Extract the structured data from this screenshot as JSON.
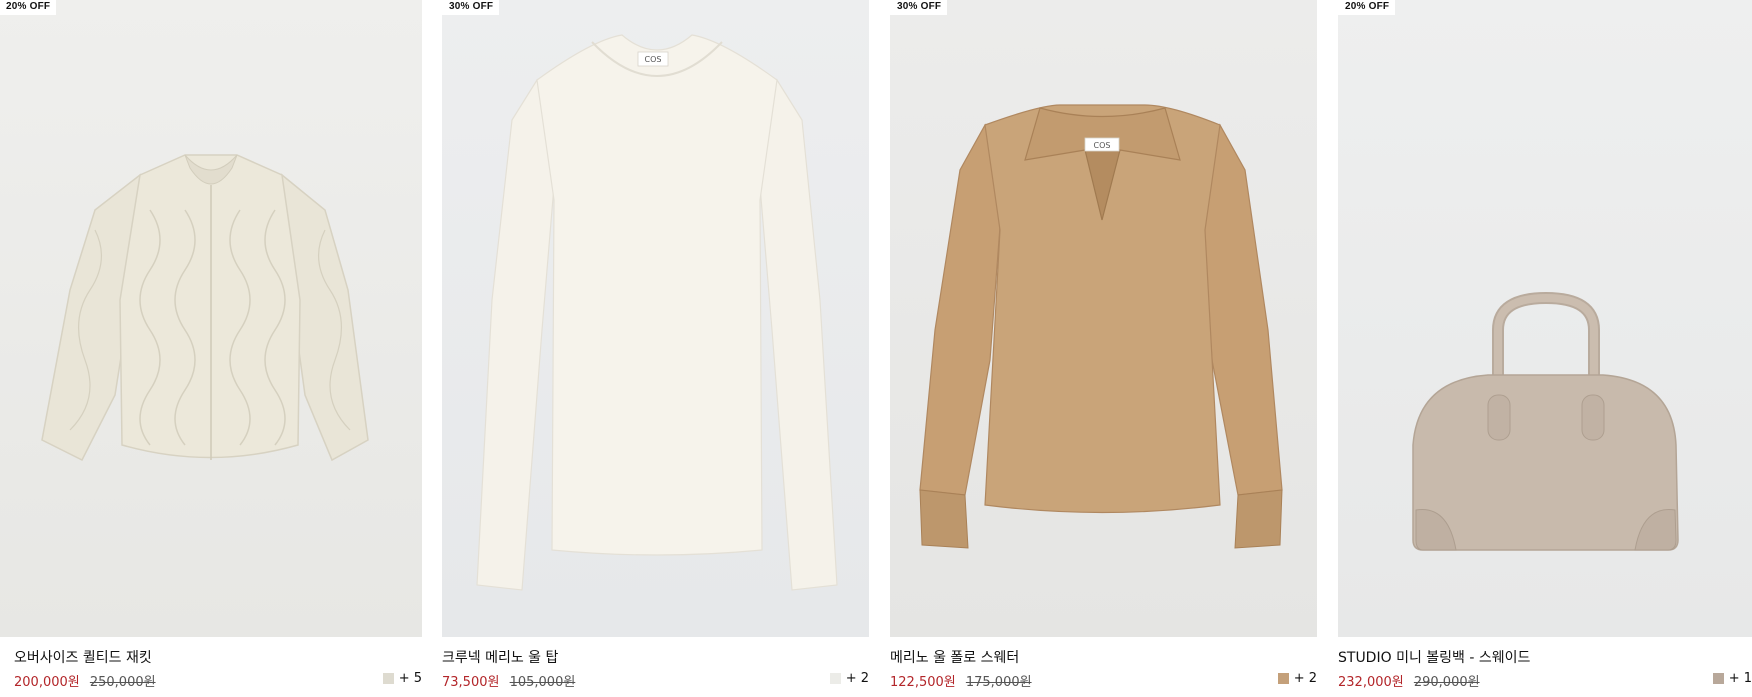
{
  "products": [
    {
      "badge": "20% OFF",
      "name": "오버사이즈 퀼티드 재킷",
      "sale_price": "200,000원",
      "original_price": "250,000원",
      "swatch_color": "#dedbd0",
      "more_colors": "+ 5",
      "image": "quilted-jacket-image"
    },
    {
      "badge": "30% OFF",
      "name": "크루넥 메리노 울 탑",
      "sale_price": "73,500원",
      "original_price": "105,000원",
      "swatch_color": "#ecece8",
      "more_colors": "+ 2",
      "image": "merino-top-image"
    },
    {
      "badge": "30% OFF",
      "name": "메리노 울 폴로 스웨터",
      "sale_price": "122,500원",
      "original_price": "175,000원",
      "swatch_color": "#c4a07a",
      "more_colors": "+ 2",
      "image": "polo-sweater-image"
    },
    {
      "badge": "20% OFF",
      "name": "STUDIO 미니 볼링백 - 스웨이드",
      "sale_price": "232,000원",
      "original_price": "290,000원",
      "swatch_color": "#b8a89a",
      "more_colors": "+ 1",
      "image": "bowling-bag-image"
    }
  ],
  "colors": {
    "sale_price": "#b3262a",
    "jacket": "#ebe7da",
    "top": "#f5f2ea",
    "sweater": "#c9a57d",
    "bag": "#c6b8aa"
  }
}
